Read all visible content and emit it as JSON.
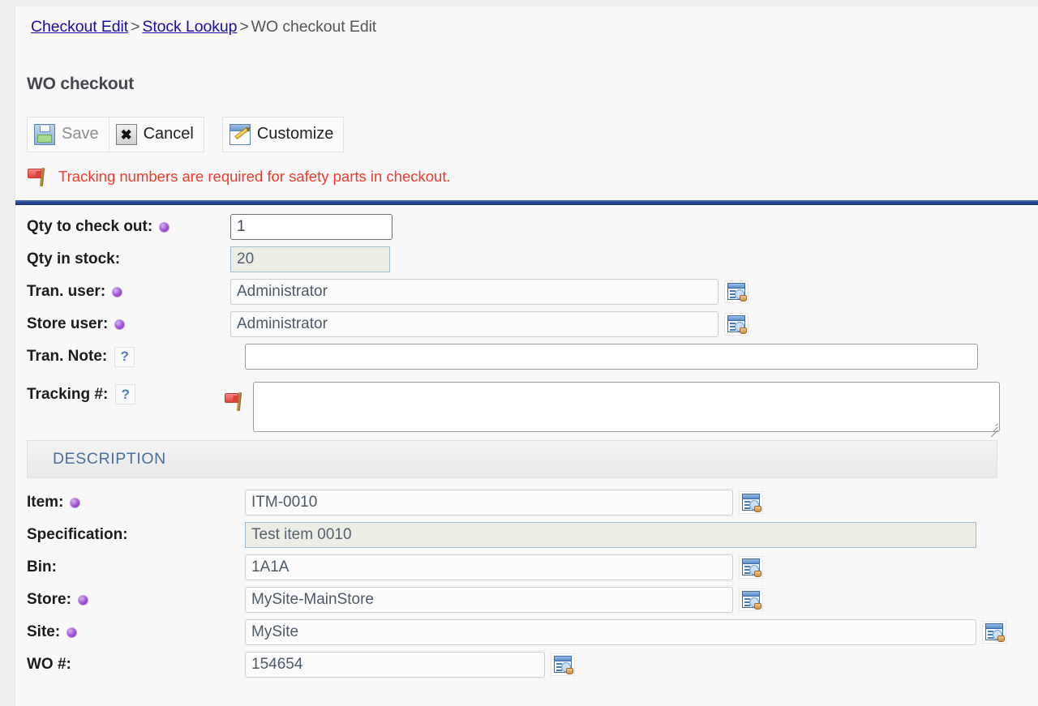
{
  "breadcrumb": {
    "links": [
      {
        "label": "Checkout Edit"
      },
      {
        "label": "Stock Lookup"
      }
    ],
    "separator": ">",
    "current": "WO checkout Edit"
  },
  "page": {
    "title": "WO checkout"
  },
  "toolbar": {
    "save_label": "Save",
    "cancel_label": "Cancel",
    "customize_label": "Customize",
    "save_icon": "floppy-disk-icon",
    "cancel_icon": "cancel-x-icon",
    "customize_icon": "window-pencil-icon"
  },
  "warning": {
    "icon": "red-flag-icon",
    "text": "Tracking numbers are required for safety parts in checkout.",
    "color": "#ef3b2d"
  },
  "colors": {
    "link": "#1a0dab",
    "divider": "#24408e",
    "required_dot": "#a24fd8",
    "section_title": "#4a6f9e",
    "readonly_bg": "#eceee6"
  },
  "form": {
    "fields": [
      {
        "label": "Qty to check out:",
        "value": "1",
        "required": true,
        "help": false,
        "readonly": false,
        "lookup": false
      },
      {
        "label": "Qty in stock:",
        "value": "20",
        "required": false,
        "help": false,
        "readonly": true,
        "lookup": false
      },
      {
        "label": "Tran. user:",
        "value": "Administrator",
        "required": true,
        "help": false,
        "readonly": false,
        "lookup": true
      },
      {
        "label": "Store user:",
        "value": "Administrator",
        "required": true,
        "help": false,
        "readonly": false,
        "lookup": true
      },
      {
        "label": "Tran. Note:",
        "value": "",
        "required": false,
        "help": true,
        "help_label": "?",
        "readonly": false,
        "lookup": false
      },
      {
        "label": "Tracking #:",
        "value": "",
        "required": false,
        "help": true,
        "help_label": "?",
        "flag": true,
        "readonly": false,
        "lookup": false
      }
    ]
  },
  "section": {
    "title": "DESCRIPTION",
    "fields": [
      {
        "label": "Item:",
        "value": "ITM-0010",
        "required": true,
        "readonly": false,
        "lookup": true
      },
      {
        "label": "Specification:",
        "value": "Test item 0010",
        "required": false,
        "readonly": true,
        "lookup": false
      },
      {
        "label": "Bin:",
        "value": "1A1A",
        "required": false,
        "readonly": false,
        "lookup": true
      },
      {
        "label": "Store:",
        "value": "MySite-MainStore",
        "required": true,
        "readonly": false,
        "lookup": true
      },
      {
        "label": "Site:",
        "value": "MySite",
        "required": true,
        "readonly": false,
        "lookup": true
      },
      {
        "label": "WO #:",
        "value": "154654",
        "required": false,
        "readonly": false,
        "lookup": true
      }
    ]
  }
}
